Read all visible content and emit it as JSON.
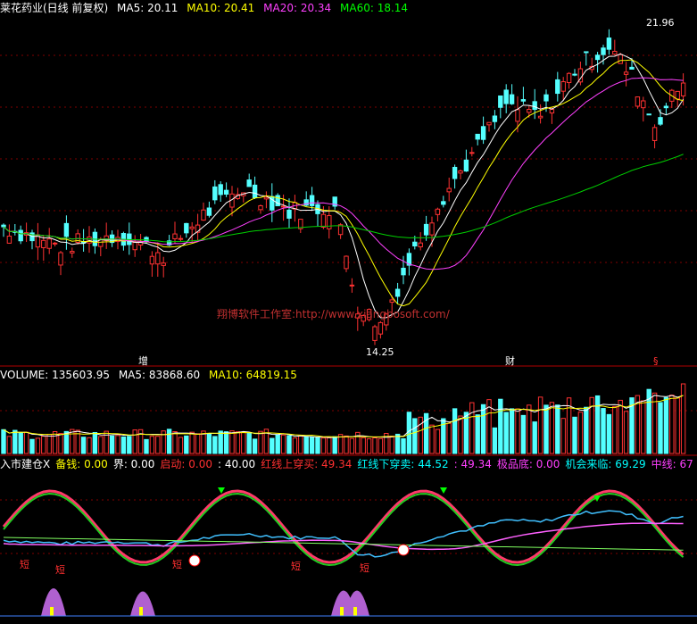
{
  "header": {
    "title": "莱花药业(日线 前复权)",
    "ma5": "MA5: 20.11",
    "ma10": "MA10: 20.41",
    "ma20": "MA20: 20.34",
    "ma60": "MA60: 18.14"
  },
  "price_panel": {
    "high_label": "21.96",
    "low_label": "14.25",
    "watermark": "翔博软件工作室:http://www.xiangbosoft.com/",
    "event_tags": [
      "增",
      "财",
      "§"
    ]
  },
  "volume_panel": {
    "volume": "VOLUME: 135603.95",
    "ma5": "MA5: 83868.60",
    "ma10": "MA10: 64819.15"
  },
  "indicator_panel": {
    "labels": [
      {
        "text": "入市建仓X",
        "color": "#ffffff"
      },
      {
        "text": "备钱: 0.00",
        "color": "#ffff00"
      },
      {
        "text": "界: 0.00",
        "color": "#ffffff"
      },
      {
        "text": "启动: 0.00",
        "color": "#ff3030"
      },
      {
        "text": ": 40.00",
        "color": "#ffffff"
      },
      {
        "text": "红线上穿买: 49.34",
        "color": "#ff3030"
      },
      {
        "text": "红线下穿卖: 44.52",
        "color": "#00ffff"
      },
      {
        "text": ": 49.34",
        "color": "#ff40ff"
      },
      {
        "text": "极品底: 0.00",
        "color": "#ff40ff"
      },
      {
        "text": "机会来临: 69.29",
        "color": "#00ffff"
      },
      {
        "text": "中线: 67",
        "color": "#ff40ff"
      }
    ],
    "short_marks": [
      "短",
      "短",
      "短",
      "短",
      "短"
    ]
  },
  "colors": {
    "bull": "#ff3232",
    "bear": "#54ffff",
    "ma5": "#ffffff",
    "ma10": "#ffff00",
    "ma20": "#ff40ff",
    "ma60": "#00d000",
    "grid": "#800000"
  },
  "chart_data": {
    "type": "line",
    "x_count": 120,
    "price_range": [
      14.25,
      21.96
    ],
    "indicator_range": [
      0,
      100
    ],
    "series": [
      {
        "name": "MA5",
        "values": [
          20.11
        ]
      },
      {
        "name": "MA10",
        "values": [
          20.41
        ]
      },
      {
        "name": "MA20",
        "values": [
          20.34
        ]
      },
      {
        "name": "MA60",
        "values": [
          18.14
        ]
      },
      {
        "name": "VOLUME",
        "values": [
          135603.95
        ]
      },
      {
        "name": "MA5",
        "values": [
          83868.6
        ]
      },
      {
        "name": "MA10",
        "values": [
          64819.15
        ]
      }
    ]
  }
}
